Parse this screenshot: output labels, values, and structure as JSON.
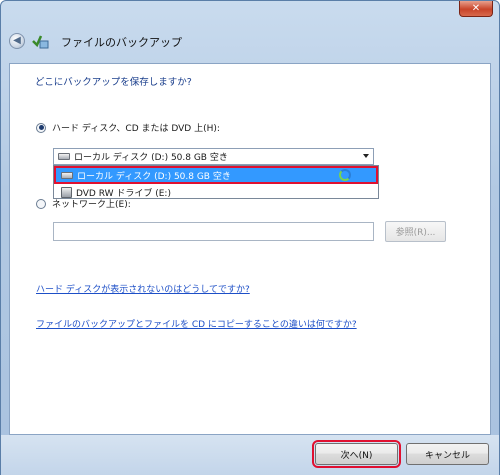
{
  "window": {
    "title": "ファイルのバックアップ",
    "close_glyph": "✕"
  },
  "heading": "どこにバックアップを保存しますか?",
  "options": {
    "hard_disk_label": "ハード ディスク、CD または DVD 上(H):",
    "hard_disk_selected": true,
    "network_label": "ネットワーク上(E):",
    "network_selected": false
  },
  "dropdown": {
    "value": "ローカル ディスク (D:)  50.8 GB 空き",
    "items": [
      {
        "label": "ローカル ディスク (D:)  50.8 GB 空き",
        "icon": "hard-drive-icon",
        "highlighted": true
      },
      {
        "label": "DVD RW ドライブ (E:)",
        "icon": "dvd-drive-icon",
        "highlighted": false
      }
    ]
  },
  "network_path": {
    "value": ""
  },
  "browse_label": "参照(R)...",
  "links": {
    "missing_disk": "ハード ディスクが表示されないのはどうしてですか?",
    "backup_vs_copy": "ファイルのバックアップとファイルを CD にコピーすることの違いは何ですか?"
  },
  "footer": {
    "next_label": "次へ(N)",
    "cancel_label": "キャンセル"
  },
  "colors": {
    "highlight": "#3399ff",
    "annotation_border": "#e01030",
    "link": "#1d4fc7"
  }
}
